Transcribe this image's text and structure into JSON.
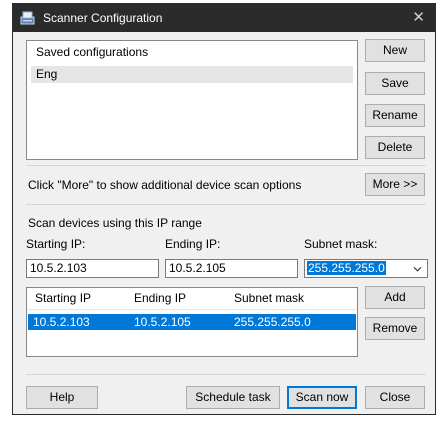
{
  "window": {
    "title": "Scanner Configuration",
    "close_glyph": "✕",
    "icon": "scanner-icon"
  },
  "saved": {
    "items": [
      "Saved configurations",
      "Eng"
    ],
    "buttons": {
      "new": "New",
      "save": "Save",
      "rename": "Rename",
      "delete": "Delete"
    }
  },
  "more": {
    "hint": "Click \"More\" to show additional device scan options",
    "button": "More >>"
  },
  "range": {
    "heading": "Scan devices using this IP range",
    "start_label": "Starting  IP:",
    "end_label": "Ending IP:",
    "mask_label": "Subnet mask:",
    "start_value": "10.5.2.103",
    "end_value": "10.5.2.105",
    "mask_value": "255.255.255.0"
  },
  "ranges_table": {
    "headers": [
      "Starting IP",
      "Ending IP",
      "Subnet mask"
    ],
    "rows": [
      [
        "10.5.2.103",
        "10.5.2.105",
        "255.255.255.0"
      ]
    ],
    "buttons": {
      "add": "Add",
      "remove": "Remove"
    }
  },
  "footer": {
    "help": "Help",
    "schedule": "Schedule task",
    "scan_now": "Scan now",
    "close": "Close"
  },
  "colors": {
    "titlebar": "#2b2b2b",
    "selection": "#0078d7",
    "dialog_bg": "#f0f0f0"
  }
}
